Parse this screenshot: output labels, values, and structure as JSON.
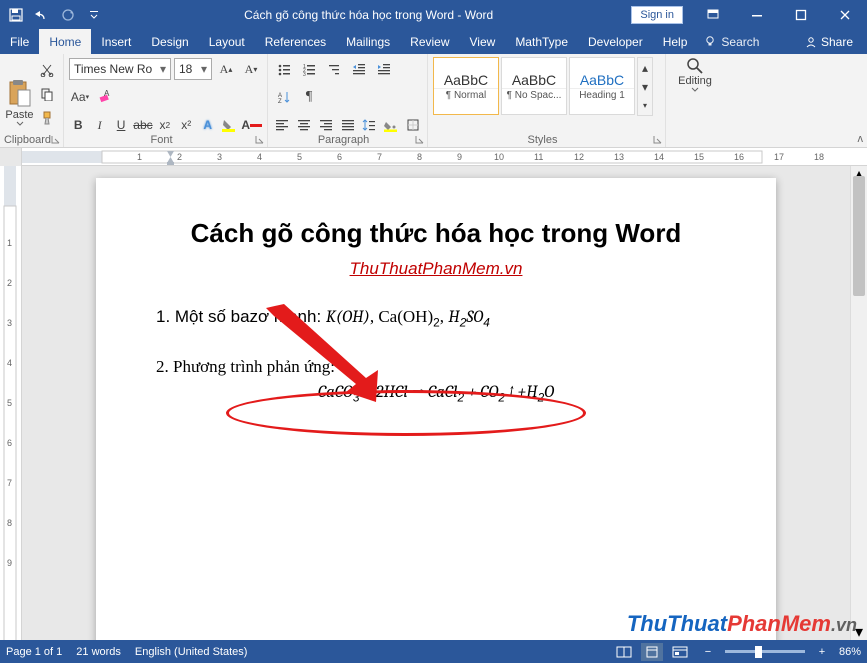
{
  "title": "Cách gõ công thức hóa học trong Word  -  Word",
  "signin": "Sign in",
  "tabs": {
    "file": "File",
    "home": "Home",
    "insert": "Insert",
    "design": "Design",
    "layout": "Layout",
    "references": "References",
    "mailings": "Mailings",
    "review": "Review",
    "view": "View",
    "mathtype": "MathType",
    "developer": "Developer",
    "help": "Help",
    "tellme": "Search",
    "share": "Share"
  },
  "ribbon": {
    "clipboard": {
      "label": "Clipboard",
      "paste": "Paste"
    },
    "font": {
      "label": "Font",
      "name": "Times New Ro",
      "size": "18"
    },
    "paragraph": {
      "label": "Paragraph"
    },
    "styles": {
      "label": "Styles",
      "items": [
        {
          "preview": "AaBbC",
          "name": "¶ Normal"
        },
        {
          "preview": "AaBbC",
          "name": "¶ No Spac..."
        },
        {
          "preview": "AaBbC",
          "name": "Heading 1"
        }
      ]
    },
    "editing": {
      "label": "Editing"
    }
  },
  "document": {
    "heading": "Cách gõ công thức hóa học trong Word",
    "source": "ThuThuatPhanMem.vn",
    "line1_prefix": "1. Một số bazơ mạnh: ",
    "line2": "2. Phương trình phản ứng:"
  },
  "status": {
    "page": "Page 1 of 1",
    "words": "21 words",
    "lang": "English (United States)",
    "zoom": "86%"
  },
  "watermark": {
    "a": "ThuThuat",
    "b": "PhanMem",
    "c": ".vn"
  }
}
